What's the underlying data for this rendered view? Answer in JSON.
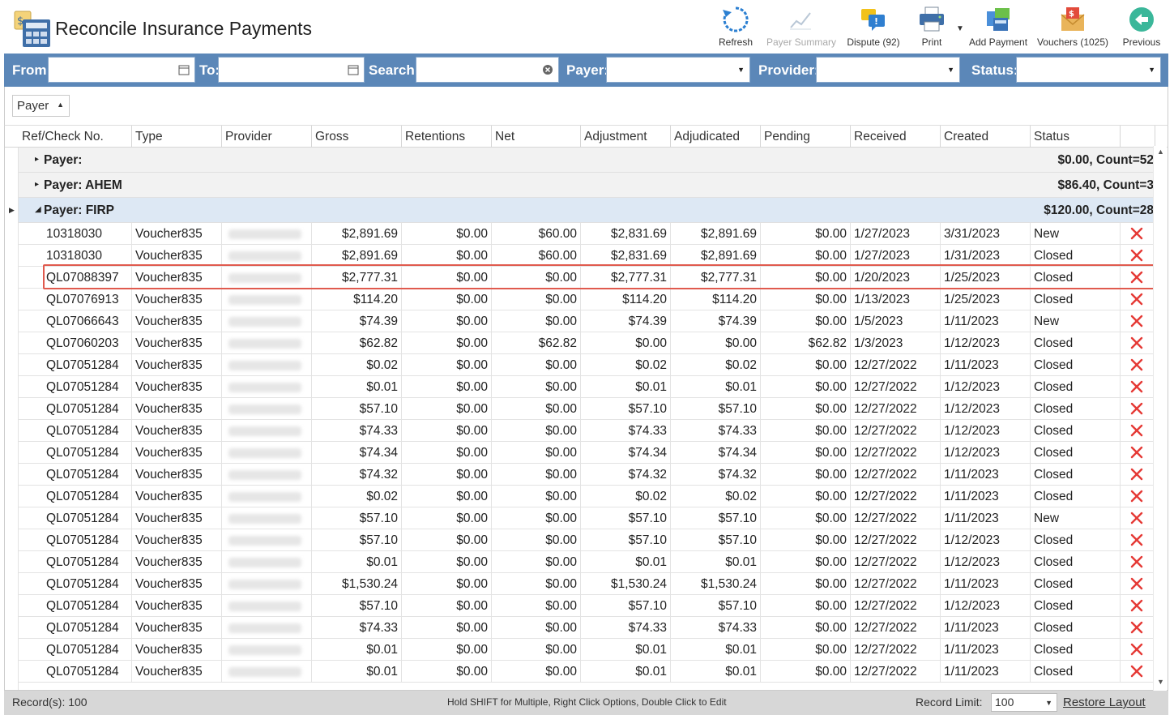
{
  "window": {
    "title": "Reconcile Insurance Payments"
  },
  "toolbar": {
    "refresh": "Refresh",
    "payer_summary": "Payer Summary",
    "dispute": "Dispute (92)",
    "print": "Print",
    "add_payment": "Add Payment",
    "vouchers": "Vouchers (1025)",
    "previous": "Previous"
  },
  "filters": {
    "from_label": "From:",
    "to_label": "To:",
    "search_label": "Search:",
    "payer_label": "Payer:",
    "provider_label": "Provider:",
    "status_label": "Status:"
  },
  "group_panel": {
    "chip": "Payer"
  },
  "columns": [
    "Ref/Check No.",
    "Type",
    "Provider",
    "Gross",
    "Retentions",
    "Net",
    "Adjustment",
    "Adjudicated",
    "Pending",
    "Received",
    "Created",
    "Status"
  ],
  "groups": [
    {
      "name": "Payer:",
      "summary": "$0.00,  Count=52"
    },
    {
      "name": "Payer: AHEM",
      "summary": "$86.40,  Count=3"
    },
    {
      "name": "Payer: FIRP",
      "summary": "$120.00,  Count=28"
    }
  ],
  "rows": [
    [
      "10318030",
      "Voucher835",
      "",
      "$2,891.69",
      "$0.00",
      "$60.00",
      "$2,831.69",
      "$2,891.69",
      "$0.00",
      "1/27/2023",
      "3/31/2023",
      "New"
    ],
    [
      "10318030",
      "Voucher835",
      "",
      "$2,891.69",
      "$0.00",
      "$60.00",
      "$2,831.69",
      "$2,891.69",
      "$0.00",
      "1/27/2023",
      "1/31/2023",
      "Closed"
    ],
    [
      "QL07088397",
      "Voucher835",
      "",
      "$2,777.31",
      "$0.00",
      "$0.00",
      "$2,777.31",
      "$2,777.31",
      "$0.00",
      "1/20/2023",
      "1/25/2023",
      "Closed"
    ],
    [
      "QL07076913",
      "Voucher835",
      "",
      "$114.20",
      "$0.00",
      "$0.00",
      "$114.20",
      "$114.20",
      "$0.00",
      "1/13/2023",
      "1/25/2023",
      "Closed"
    ],
    [
      "QL07066643",
      "Voucher835",
      "",
      "$74.39",
      "$0.00",
      "$0.00",
      "$74.39",
      "$74.39",
      "$0.00",
      "1/5/2023",
      "1/11/2023",
      "New"
    ],
    [
      "QL07060203",
      "Voucher835",
      "",
      "$62.82",
      "$0.00",
      "$62.82",
      "$0.00",
      "$0.00",
      "$62.82",
      "1/3/2023",
      "1/12/2023",
      "Closed"
    ],
    [
      "QL07051284",
      "Voucher835",
      "",
      "$0.02",
      "$0.00",
      "$0.00",
      "$0.02",
      "$0.02",
      "$0.00",
      "12/27/2022",
      "1/11/2023",
      "Closed"
    ],
    [
      "QL07051284",
      "Voucher835",
      "",
      "$0.01",
      "$0.00",
      "$0.00",
      "$0.01",
      "$0.01",
      "$0.00",
      "12/27/2022",
      "1/12/2023",
      "Closed"
    ],
    [
      "QL07051284",
      "Voucher835",
      "",
      "$57.10",
      "$0.00",
      "$0.00",
      "$57.10",
      "$57.10",
      "$0.00",
      "12/27/2022",
      "1/12/2023",
      "Closed"
    ],
    [
      "QL07051284",
      "Voucher835",
      "",
      "$74.33",
      "$0.00",
      "$0.00",
      "$74.33",
      "$74.33",
      "$0.00",
      "12/27/2022",
      "1/12/2023",
      "Closed"
    ],
    [
      "QL07051284",
      "Voucher835",
      "",
      "$74.34",
      "$0.00",
      "$0.00",
      "$74.34",
      "$74.34",
      "$0.00",
      "12/27/2022",
      "1/12/2023",
      "Closed"
    ],
    [
      "QL07051284",
      "Voucher835",
      "",
      "$74.32",
      "$0.00",
      "$0.00",
      "$74.32",
      "$74.32",
      "$0.00",
      "12/27/2022",
      "1/11/2023",
      "Closed"
    ],
    [
      "QL07051284",
      "Voucher835",
      "",
      "$0.02",
      "$0.00",
      "$0.00",
      "$0.02",
      "$0.02",
      "$0.00",
      "12/27/2022",
      "1/11/2023",
      "Closed"
    ],
    [
      "QL07051284",
      "Voucher835",
      "",
      "$57.10",
      "$0.00",
      "$0.00",
      "$57.10",
      "$57.10",
      "$0.00",
      "12/27/2022",
      "1/11/2023",
      "New"
    ],
    [
      "QL07051284",
      "Voucher835",
      "",
      "$57.10",
      "$0.00",
      "$0.00",
      "$57.10",
      "$57.10",
      "$0.00",
      "12/27/2022",
      "1/12/2023",
      "Closed"
    ],
    [
      "QL07051284",
      "Voucher835",
      "",
      "$0.01",
      "$0.00",
      "$0.00",
      "$0.01",
      "$0.01",
      "$0.00",
      "12/27/2022",
      "1/12/2023",
      "Closed"
    ],
    [
      "QL07051284",
      "Voucher835",
      "",
      "$1,530.24",
      "$0.00",
      "$0.00",
      "$1,530.24",
      "$1,530.24",
      "$0.00",
      "12/27/2022",
      "1/11/2023",
      "Closed"
    ],
    [
      "QL07051284",
      "Voucher835",
      "",
      "$57.10",
      "$0.00",
      "$0.00",
      "$57.10",
      "$57.10",
      "$0.00",
      "12/27/2022",
      "1/12/2023",
      "Closed"
    ],
    [
      "QL07051284",
      "Voucher835",
      "",
      "$74.33",
      "$0.00",
      "$0.00",
      "$74.33",
      "$74.33",
      "$0.00",
      "12/27/2022",
      "1/11/2023",
      "Closed"
    ],
    [
      "QL07051284",
      "Voucher835",
      "",
      "$0.01",
      "$0.00",
      "$0.00",
      "$0.01",
      "$0.01",
      "$0.00",
      "12/27/2022",
      "1/11/2023",
      "Closed"
    ],
    [
      "QL07051284",
      "Voucher835",
      "",
      "$0.01",
      "$0.00",
      "$0.00",
      "$0.01",
      "$0.01",
      "$0.00",
      "12/27/2022",
      "1/11/2023",
      "Closed"
    ]
  ],
  "statusbar": {
    "records": "Record(s): 100",
    "hint": "Hold SHIFT for Multiple, Right Click Options, Double Click to Edit",
    "record_limit_label": "Record Limit:",
    "record_limit_value": "100",
    "restore_layout": "Restore Layout"
  },
  "colors": {
    "filterbar": "#5b87b8",
    "delete": "#e53935",
    "selected_outline": "#e05a4e",
    "group_expanded": "#dde8f4"
  }
}
